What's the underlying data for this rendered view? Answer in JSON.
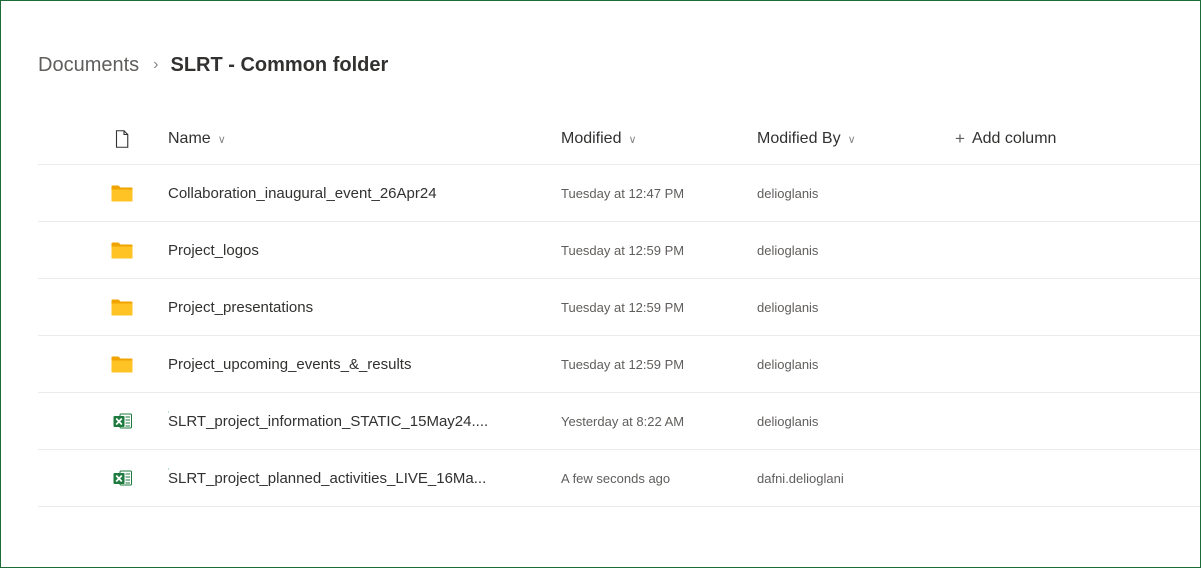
{
  "breadcrumb": {
    "parent": "Documents",
    "separator": "›",
    "current": "SLRT - Common folder"
  },
  "header": {
    "name": "Name",
    "modified": "Modified",
    "modified_by": "Modified By",
    "add_column": "Add column",
    "add_symbol": "+",
    "sort_chevron": "∨"
  },
  "icons": {
    "file_header": "document-icon",
    "folder": "folder-icon",
    "excel": "excel-icon",
    "new_item": "new-item-sparkle-icon"
  },
  "colors": {
    "folder": "#ffc326",
    "excel": "#1d7a3e",
    "border": "#1e6b3a",
    "new_marker": "#0f9d58"
  },
  "rows": [
    {
      "type": "folder",
      "name": "Collaboration_inaugural_event_26Apr24",
      "modified": "Tuesday at 12:47 PM",
      "modified_by": "delioglanis"
    },
    {
      "type": "folder",
      "name": "Project_logos",
      "modified": "Tuesday at 12:59 PM",
      "modified_by": "delioglanis"
    },
    {
      "type": "folder",
      "name": "Project_presentations",
      "modified": "Tuesday at 12:59 PM",
      "modified_by": "delioglanis"
    },
    {
      "type": "folder",
      "name": "Project_upcoming_events_&_results",
      "modified": "Tuesday at 12:59 PM",
      "modified_by": "delioglanis"
    },
    {
      "type": "excel",
      "name": "SLRT_project_information_STATIC_15May24....",
      "modified": "Yesterday at 8:22 AM",
      "modified_by": "delioglanis"
    },
    {
      "type": "excel",
      "name": "SLRT_project_planned_activities_LIVE_16Ma...",
      "modified": "A few seconds ago",
      "modified_by": "dafni.delioglani"
    }
  ]
}
